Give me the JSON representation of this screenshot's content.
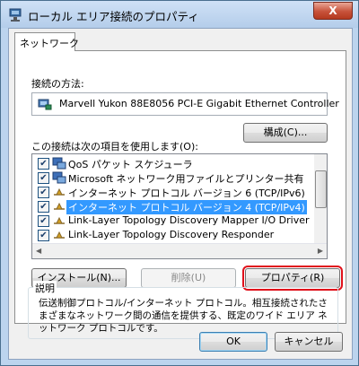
{
  "window": {
    "title": "ローカル エリア接続のプロパティ",
    "close_label": "X"
  },
  "tabs": [
    {
      "label": "ネットワーク",
      "selected": true
    }
  ],
  "connect_using": {
    "label": "接続の方法:",
    "adapter_name": "Marvell Yukon 88E8056 PCI-E Gigabit Ethernet Controller",
    "configure_label": "構成(C)..."
  },
  "items_list": {
    "label": "この接続は次の項目を使用します(O):",
    "items": [
      {
        "label": "QoS パケット スケジューラ",
        "checked": true,
        "icon": "qos-icon",
        "selected": false
      },
      {
        "label": "Microsoft ネットワーク用ファイルとプリンター共有",
        "checked": true,
        "icon": "file-printer-sharing-icon",
        "selected": false
      },
      {
        "label": "インターネット プロトコル バージョン 6 (TCP/IPv6)",
        "checked": true,
        "icon": "protocol-icon",
        "selected": false
      },
      {
        "label": "インターネット プロトコル バージョン 4 (TCP/IPv4)",
        "checked": true,
        "icon": "protocol-icon",
        "selected": true
      },
      {
        "label": "Link-Layer Topology Discovery Mapper I/O Driver",
        "checked": true,
        "icon": "protocol-icon",
        "selected": false
      },
      {
        "label": "Link-Layer Topology Discovery Responder",
        "checked": true,
        "icon": "protocol-icon",
        "selected": false
      }
    ]
  },
  "buttons": {
    "install": "インストール(N)...",
    "uninstall": "削除(U)",
    "properties": "プロパティ(R)",
    "ok": "OK",
    "cancel": "キャンセル"
  },
  "description": {
    "title": "説明",
    "text": "伝送制御プロトコル/インターネット プロトコル。相互接続されたさまざまなネットワーク間の通信を提供する、既定のワイド エリア ネットワーク プロトコルです。"
  },
  "colors": {
    "selection": "#3399ff",
    "highlight_outline": "#e0101a"
  }
}
